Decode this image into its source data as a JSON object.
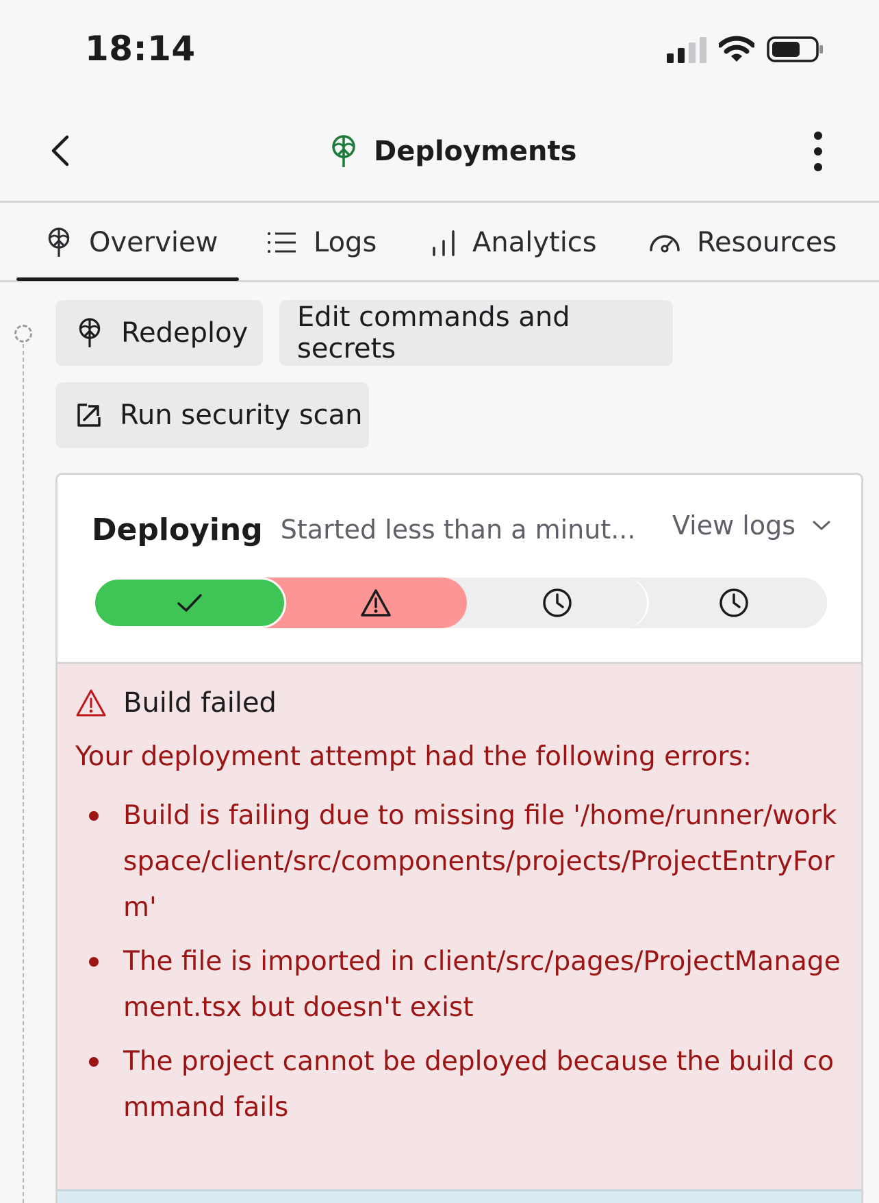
{
  "status_bar": {
    "time": "18:14",
    "signal_icon": "cellular-signal-icon",
    "wifi_icon": "wifi-icon",
    "battery_icon": "battery-icon"
  },
  "nav": {
    "title": "Deployments",
    "title_icon": "deploy-tree-icon",
    "back_icon": "chevron-left-icon",
    "more_icon": "more-vertical-icon"
  },
  "tabs": [
    {
      "label": "Overview",
      "icon": "deploy-tree-icon",
      "active": true
    },
    {
      "label": "Logs",
      "icon": "list-icon",
      "active": false
    },
    {
      "label": "Analytics",
      "icon": "bar-chart-icon",
      "active": false
    },
    {
      "label": "Resources",
      "icon": "gauge-icon",
      "active": false
    }
  ],
  "actions": {
    "redeploy": "Redeploy",
    "edit": "Edit commands and secrets",
    "scan": "Run security scan"
  },
  "deployment": {
    "status": "Deploying",
    "started": "Started less than a minut...",
    "view_logs": "View logs",
    "stages": [
      {
        "state": "success",
        "icon": "check-icon"
      },
      {
        "state": "failed",
        "icon": "warning-icon"
      },
      {
        "state": "pending",
        "icon": "clock-icon"
      },
      {
        "state": "pending",
        "icon": "clock-icon"
      }
    ],
    "colors": {
      "success": "#3fc456",
      "failed": "#fd9595",
      "pending": "#eeeef1",
      "error_text": "#9b1515",
      "error_bg": "#f5e4e6"
    }
  },
  "error": {
    "title": "Build failed",
    "intro": "Your deployment attempt had the following errors:",
    "items": [
      "Build is failing due to missing file '/home/runner/workspace/client/src/components/projects/ProjectEntryForm'",
      "The file is imported in client/src/pages/ProjectManagement.tsx but doesn't exist",
      "The project cannot be deployed because the build command fails"
    ]
  }
}
